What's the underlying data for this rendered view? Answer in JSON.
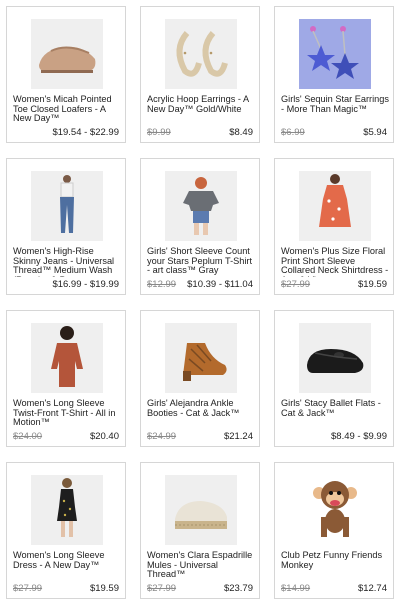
{
  "products": [
    {
      "title": "Women's Micah Pointed Toe Closed Loafers - A New Day™",
      "old": "",
      "price": "$19.54 - $22.99",
      "icon": "loafer-icon"
    },
    {
      "title": "Acrylic Hoop Earrings - A New Day™ Gold/White",
      "old": "$9.99",
      "price": "$8.49",
      "icon": "hoop-earrings-icon"
    },
    {
      "title": "Girls' Sequin Star Earrings - More Than Magic™",
      "old": "$6.99",
      "price": "$5.94",
      "icon": "star-earrings-icon"
    },
    {
      "title": "Women's High-Rise Skinny Jeans - Universal Thread™ Medium Wash (Regular & P...",
      "old": "",
      "price": "$16.99 - $19.99",
      "icon": "jeans-icon"
    },
    {
      "title": "Girls' Short Sleeve Count your Stars Peplum T-Shirt - art class™ Gray",
      "old": "$12.99",
      "price": "$10.39 - $11.04",
      "icon": "tshirt-icon"
    },
    {
      "title": "Women's Plus Size Floral Print Short Sleeve Collared Neck Shirtdress - Ava & Viv...",
      "old": "$27.99",
      "price": "$19.59",
      "icon": "dress-icon"
    },
    {
      "title": "Women's Long Sleeve Twist-Front T-Shirt - All in Motion™",
      "old": "$24.00",
      "price": "$20.40",
      "icon": "long-sleeve-shirt-icon"
    },
    {
      "title": "Girls' Alejandra Ankle Booties - Cat & Jack™",
      "old": "$24.99",
      "price": "$21.24",
      "icon": "bootie-icon"
    },
    {
      "title": "Girls' Stacy Ballet Flats - Cat & Jack™",
      "old": "",
      "price": "$8.49 - $9.99",
      "icon": "ballet-flat-icon"
    },
    {
      "title": "Women's Long Sleeve Dress - A New Day™",
      "old": "$27.99",
      "price": "$19.59",
      "icon": "black-dress-icon"
    },
    {
      "title": "Women's Clara Espadrille Mules - Universal Thread™",
      "old": "$27.99",
      "price": "$23.79",
      "icon": "mule-icon"
    },
    {
      "title": "Club Petz Funny Friends Monkey",
      "old": "$14.99",
      "price": "$12.74",
      "icon": "monkey-toy-icon"
    }
  ],
  "colors": {
    "border": "#d6d6d6",
    "old_price": "#8a8a8a",
    "text": "#222222"
  }
}
